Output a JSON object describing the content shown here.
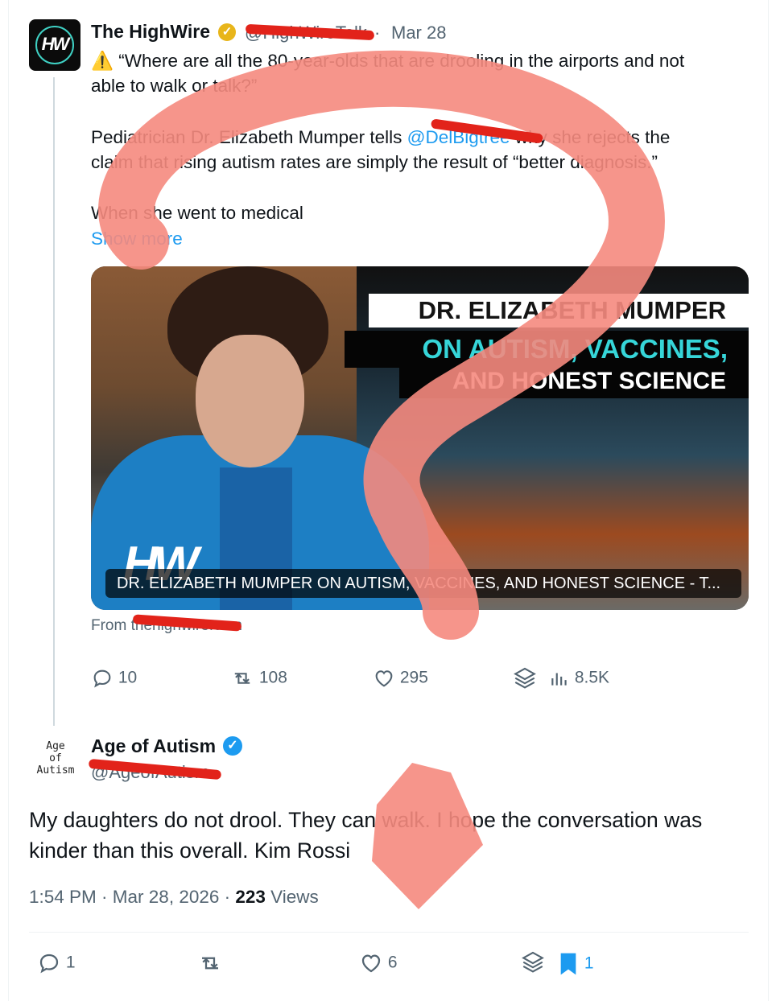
{
  "tweet1": {
    "author_name": "The HighWire",
    "handle_visible": "@HighWireTalk",
    "date": "Mar 28",
    "warning_icon": "warning-icon",
    "text_line1": "“Where are all the 80-year-olds that are drooling in the airports and not",
    "text_line2": "able to walk or talk?”",
    "text_p2_part1": "Pediatrician Dr. Elizabeth Mumper tells ",
    "text_p2_mention": "@DelBigtree",
    "text_p2_part2": " why she rejects the",
    "text_p2_line2": "claim that rising autism rates are simply the result of “better diagnosis.”",
    "text_p3": "When she went to medical",
    "show_more": "Show more",
    "card": {
      "title_line1": "DR. ELIZABETH MUMPER",
      "title_line2": "ON AUTISM, VACCINES,",
      "title_line3": "AND HONEST SCIENCE",
      "logo": "HW",
      "caption": "DR. ELIZABETH MUMPER ON AUTISM, VACCINES, AND HONEST SCIENCE - T...",
      "source": "From thehighwire.com"
    },
    "actions": {
      "replies": "10",
      "reposts": "108",
      "likes": "295",
      "views": "8.5K"
    }
  },
  "tweet2": {
    "avatar_lines": [
      "Age",
      "of",
      "Autism"
    ],
    "author_name": "Age of Autism",
    "handle_visible": "@AgeofAutism",
    "text_line1": "My daughters do not drool. They can walk.  I hope the conversation was",
    "text_line2": "kinder than this overall. Kim Rossi",
    "time": "1:54 PM · Mar 28, 2026 · ",
    "views_count": "223",
    "views_label": " Views",
    "actions": {
      "replies": "1",
      "reposts": "",
      "likes": "6",
      "bookmarks": "1"
    }
  },
  "colors": {
    "accent": "#1d9bf0",
    "muted": "#536471",
    "redaction": "#e2231a",
    "scribble": "#f58a7e"
  }
}
